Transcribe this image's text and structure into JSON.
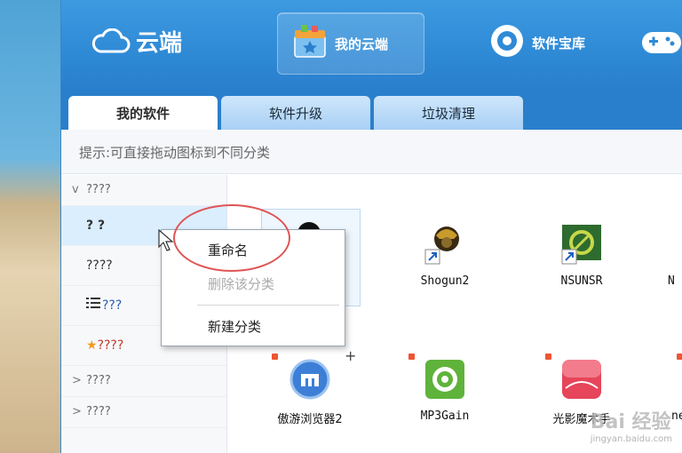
{
  "logo": {
    "text": "云端"
  },
  "nav": [
    {
      "label": "我的云端",
      "icon": "gift-box-icon",
      "active": true
    },
    {
      "label": "软件宝库",
      "icon": "disc-icon",
      "active": false
    }
  ],
  "tabs": [
    {
      "label": "我的软件",
      "active": true
    },
    {
      "label": "软件升级",
      "active": false
    },
    {
      "label": "垃圾清理",
      "active": false
    }
  ],
  "hint": "提示:可直接拖动图标到不同分类",
  "sidebar": {
    "groups": [
      {
        "label": "????",
        "expanded": true,
        "caret": "v"
      },
      {
        "label": "????",
        "expanded": false,
        "caret": ">"
      },
      {
        "label": "????",
        "expanded": false,
        "caret": ">"
      }
    ],
    "items": [
      {
        "label": "? ?",
        "selected": true
      },
      {
        "label": "????"
      },
      {
        "label": "???",
        "icon": "list-icon"
      },
      {
        "label": "????",
        "icon": "star-icon"
      }
    ]
  },
  "apps": [
    {
      "label": "Shogun2"
    },
    {
      "label": "NSUNSR"
    },
    {
      "label": "N"
    },
    {
      "label": "傲游浏览器2"
    },
    {
      "label": "MP3Gain"
    },
    {
      "label": "光影魔术手"
    },
    {
      "label": "ne"
    }
  ],
  "context_menu": {
    "items": [
      {
        "label": "重命名",
        "enabled": true
      },
      {
        "label": "删除该分类",
        "enabled": false
      },
      {
        "label": "新建分类",
        "enabled": true
      }
    ]
  },
  "watermark": {
    "line1": "Bai 经验",
    "line2": "jingyan.baidu.com"
  },
  "colors": {
    "topbar": "#2f8ad6",
    "accent_red": "#e05555",
    "selected_row": "#dbeefe"
  }
}
